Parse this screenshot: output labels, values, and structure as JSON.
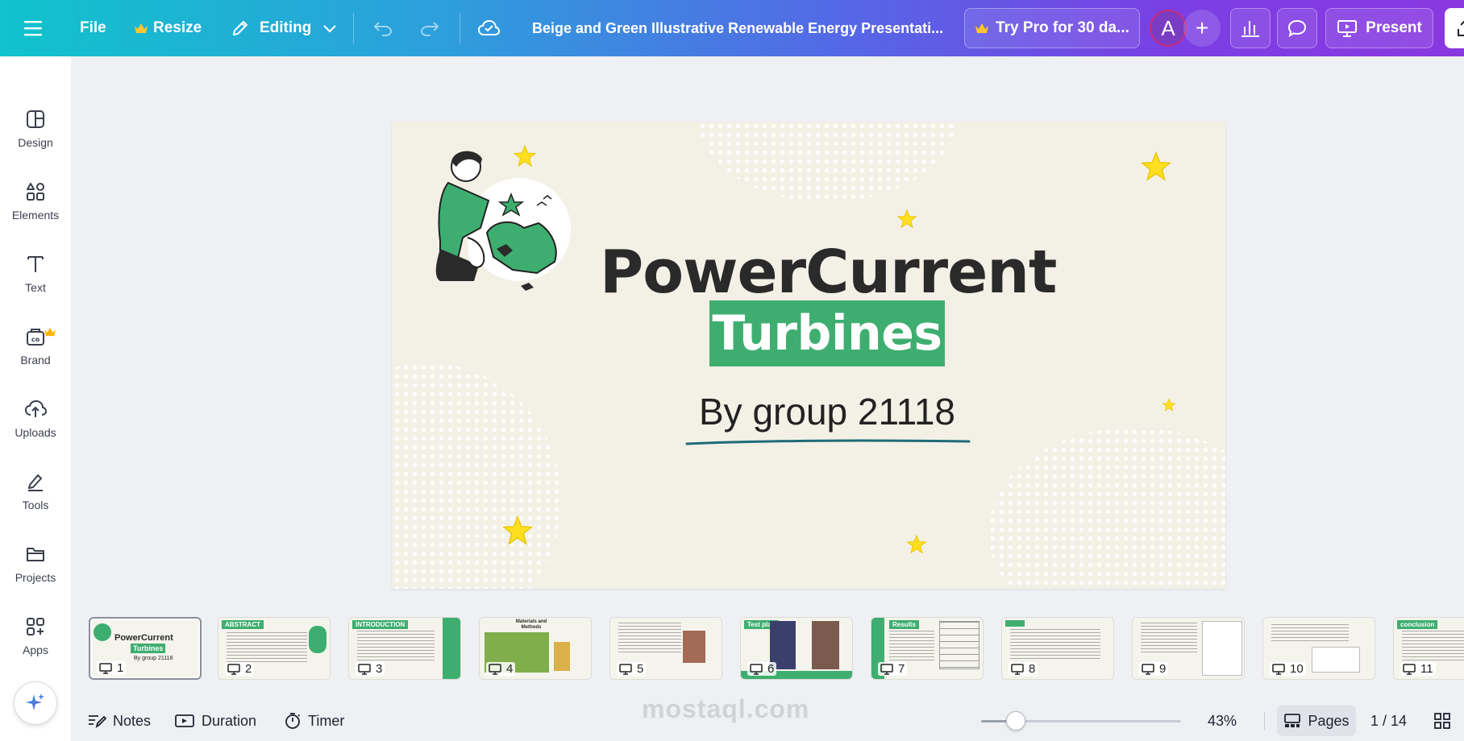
{
  "topbar": {
    "file_label": "File",
    "resize_label": "Resize",
    "editing_label": "Editing",
    "doc_title": "Beige and Green Illustrative Renewable Energy Presentati...",
    "try_pro_label": "Try Pro for 30 da...",
    "avatar_letter": "A",
    "present_label": "Present"
  },
  "sidebar": {
    "items": [
      {
        "label": "Design",
        "icon": "design-icon"
      },
      {
        "label": "Elements",
        "icon": "elements-icon"
      },
      {
        "label": "Text",
        "icon": "text-icon"
      },
      {
        "label": "Brand",
        "icon": "brand-icon"
      },
      {
        "label": "Uploads",
        "icon": "uploads-icon"
      },
      {
        "label": "Tools",
        "icon": "tools-icon"
      },
      {
        "label": "Projects",
        "icon": "projects-icon"
      },
      {
        "label": "Apps",
        "icon": "apps-icon"
      }
    ]
  },
  "slide": {
    "title_line1": "PowerCurrent",
    "title_line2": "Turbines",
    "subtitle": "By group 21118"
  },
  "thumbnails": [
    {
      "num": "1",
      "tag": "",
      "title": "PowerCurrent",
      "title2": "Turbines",
      "sub": "By group 21118"
    },
    {
      "num": "2",
      "tag": "ABSTRACT"
    },
    {
      "num": "3",
      "tag": "INTRODUCTION"
    },
    {
      "num": "4",
      "tag": "Materials and Methods"
    },
    {
      "num": "5",
      "tag": ""
    },
    {
      "num": "6",
      "tag": "Test plan"
    },
    {
      "num": "7",
      "tag": "Results"
    },
    {
      "num": "8",
      "tag": ""
    },
    {
      "num": "9",
      "tag": ""
    },
    {
      "num": "10",
      "tag": ""
    },
    {
      "num": "11",
      "tag": "conclusion"
    }
  ],
  "bottombar": {
    "notes_label": "Notes",
    "duration_label": "Duration",
    "timer_label": "Timer",
    "zoom": "43%",
    "zoom_level": 0.43,
    "pages_label": "Pages",
    "page_counter": "1 / 14"
  },
  "watermark": "mostaql.com",
  "colors": {
    "accent_green": "#3eae70",
    "slide_bg": "#f3f1e6",
    "star_yellow": "#ffdf1f",
    "underline_teal": "#1f6b78"
  }
}
